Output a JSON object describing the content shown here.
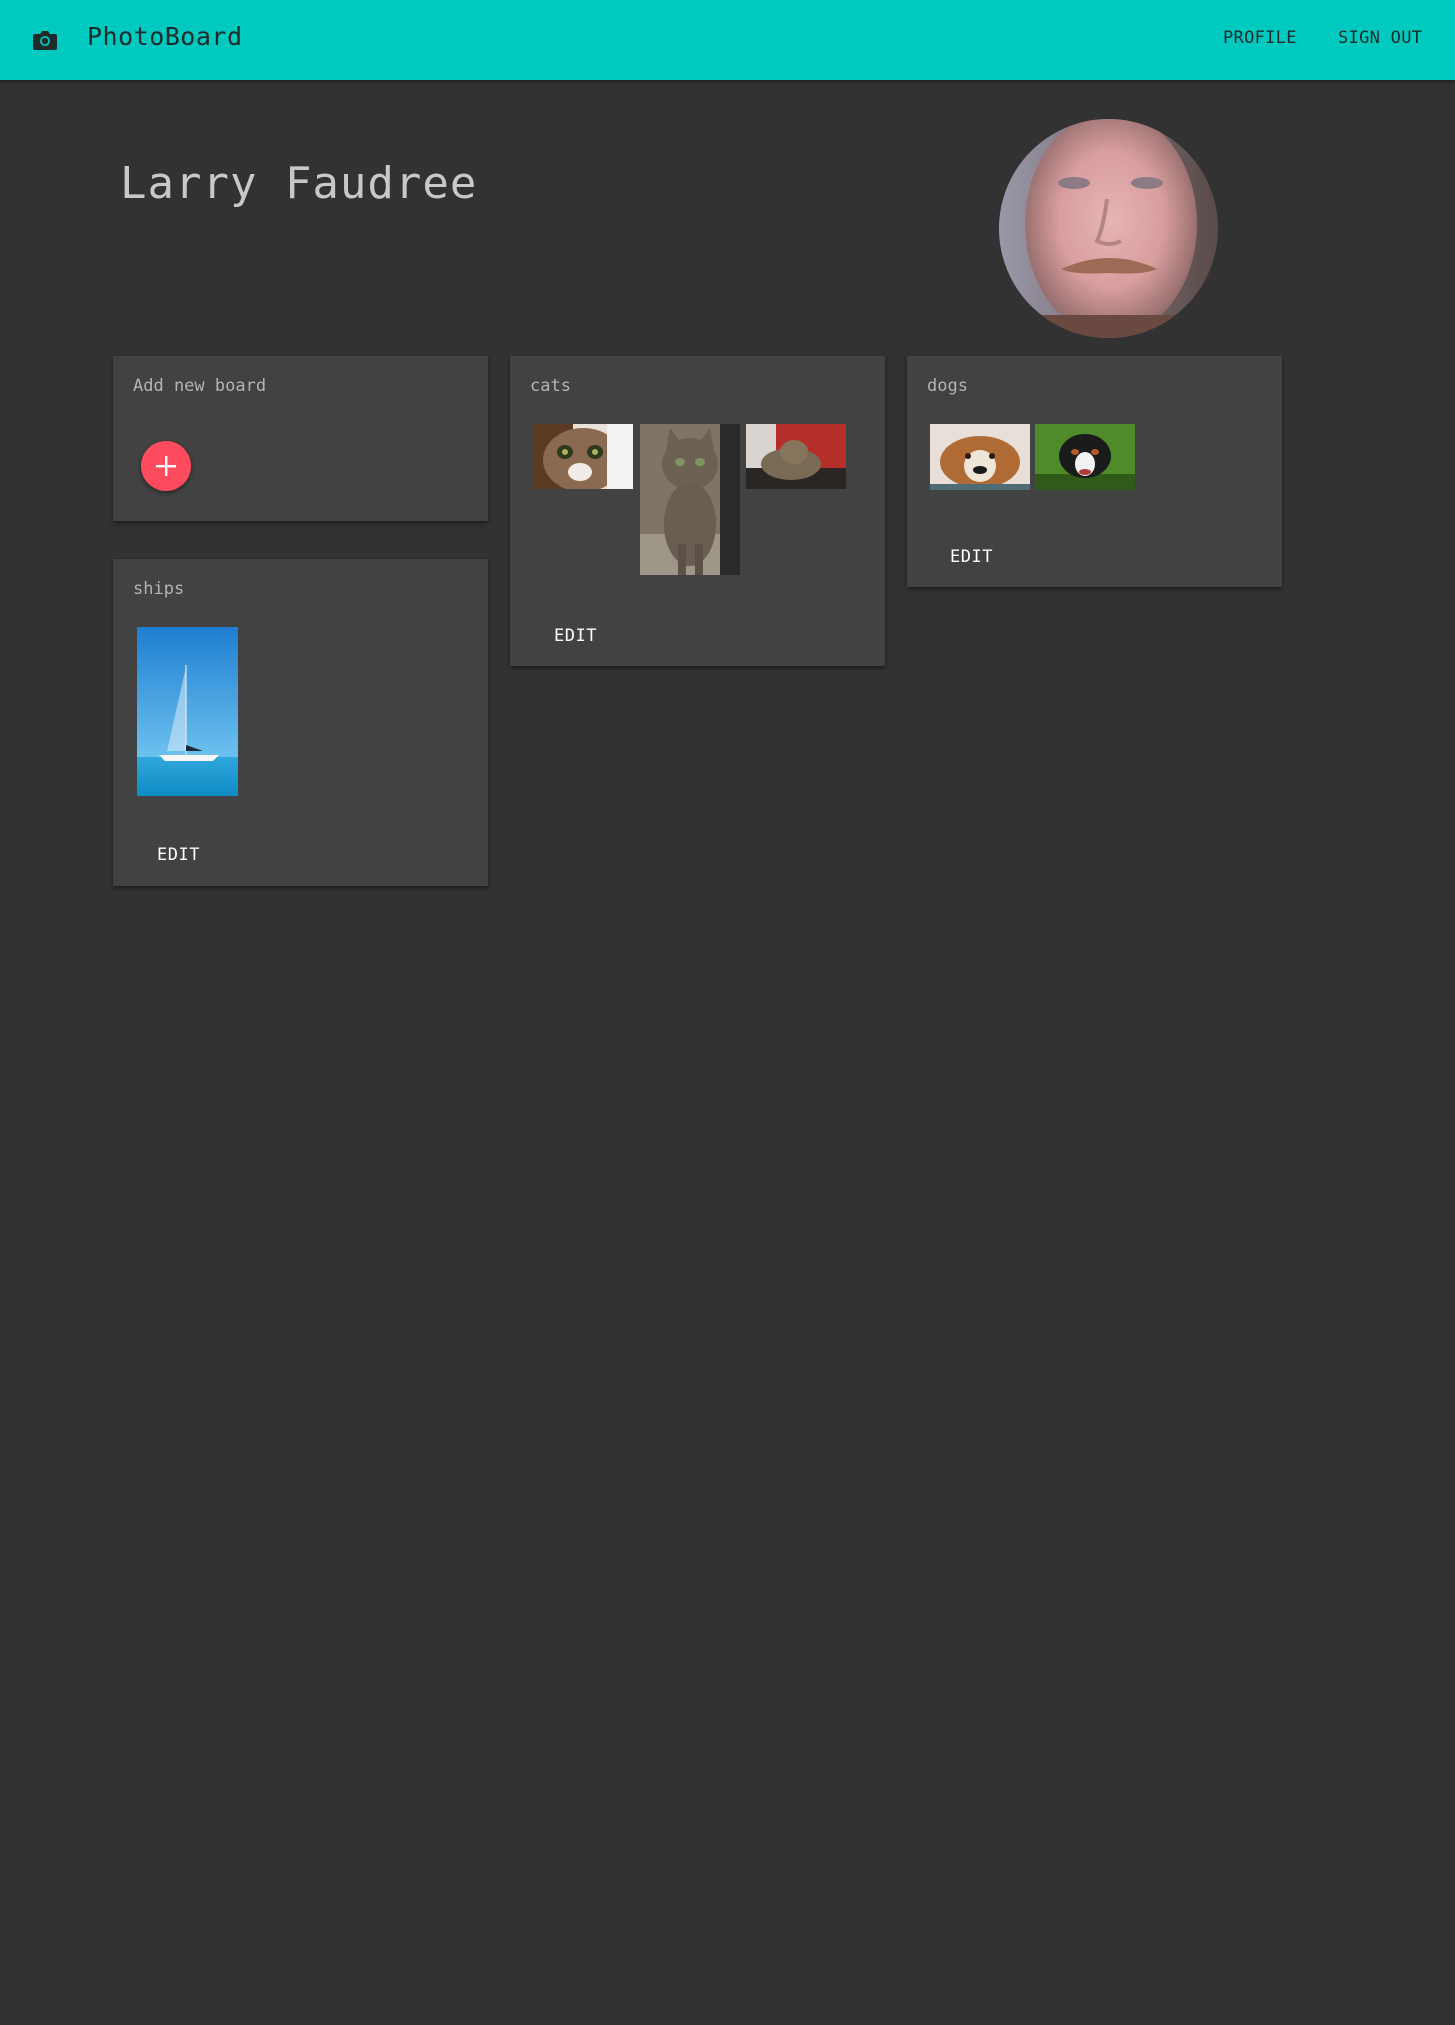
{
  "app": {
    "title": "PhotoBoard",
    "brand_color": "#00c9bf",
    "icon": "camera-icon"
  },
  "nav": {
    "profile_label": "PROFILE",
    "signout_label": "SIGN OUT"
  },
  "user": {
    "name": "Larry Faudree"
  },
  "boards": {
    "add_new": {
      "title": "Add new board",
      "button_icon": "plus-icon",
      "button_color": "#ff4b5e"
    },
    "cats": {
      "title": "cats",
      "edit_label": "EDIT",
      "photo_count": 3
    },
    "dogs": {
      "title": "dogs",
      "edit_label": "EDIT",
      "photo_count": 2
    },
    "ships": {
      "title": "ships",
      "edit_label": "EDIT",
      "photo_count": 1
    }
  }
}
